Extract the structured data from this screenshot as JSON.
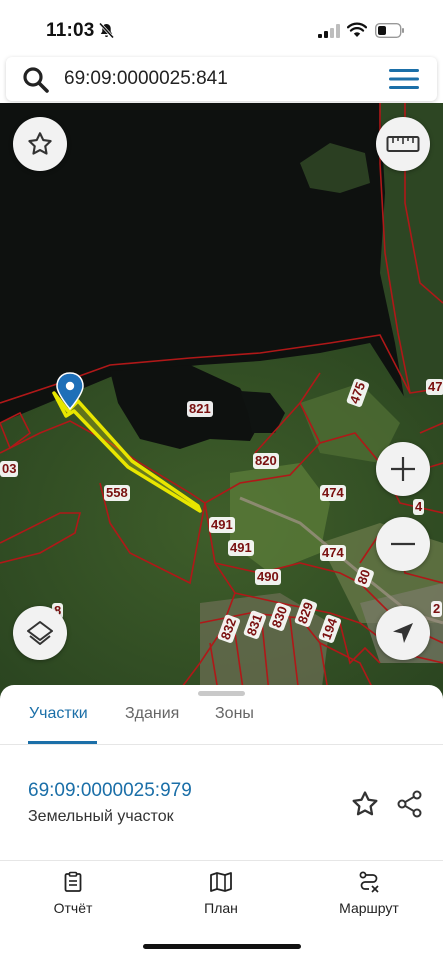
{
  "status_bar": {
    "time": "11:03"
  },
  "search": {
    "value": "69:09:0000025:841"
  },
  "map": {
    "parcel_labels": [
      "821",
      "475",
      "47",
      "820",
      "474",
      "558",
      "491",
      "491",
      "474",
      "03",
      "490",
      "80",
      "832",
      "831",
      "830",
      "829",
      "194",
      "8",
      "4",
      "2"
    ]
  },
  "sheet": {
    "tabs": [
      "Участки",
      "Здания",
      "Зоны"
    ],
    "active_tab": "Участки",
    "result": {
      "id": "69:09:0000025:979",
      "type": "Земельный участок"
    }
  },
  "bottom_nav": {
    "report": "Отчёт",
    "plan": "План",
    "route": "Маршрут"
  }
}
